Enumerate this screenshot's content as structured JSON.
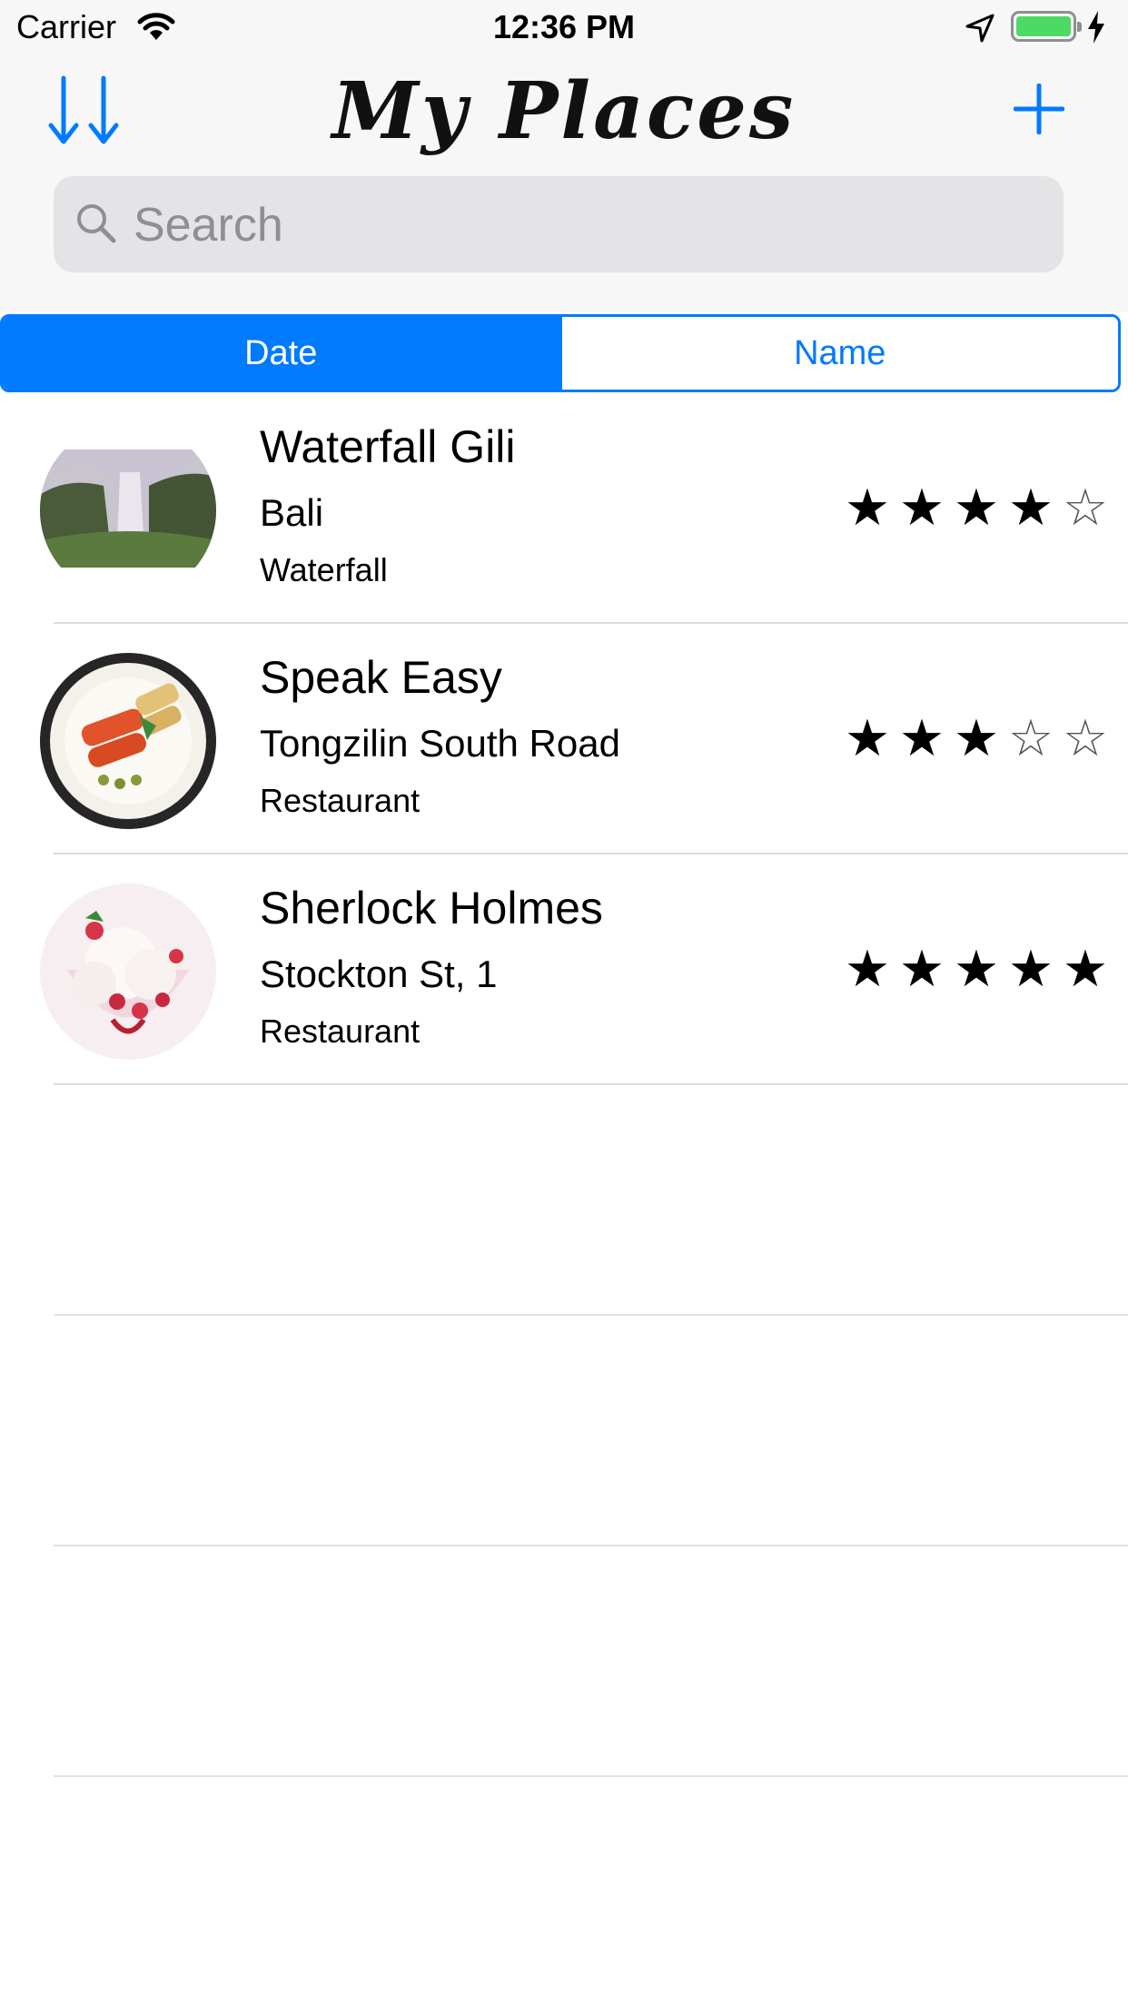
{
  "status_bar": {
    "carrier": "Carrier",
    "time": "12:36 PM",
    "battery_level": 1.0
  },
  "nav": {
    "title": "My Places",
    "sort_icon": "sort-arrows-icon",
    "add_icon": "plus-icon"
  },
  "search": {
    "placeholder": "Search",
    "icon": "search-icon"
  },
  "segments": [
    {
      "label": "Date",
      "selected": true
    },
    {
      "label": "Name",
      "selected": false
    }
  ],
  "places": [
    {
      "name": "Waterfall Gili",
      "location": "Bali",
      "type": "Waterfall",
      "rating": 4,
      "max_rating": 5,
      "image": "waterfall-photo"
    },
    {
      "name": "Speak Easy",
      "location": "Tongzilin South Road",
      "type": "Restaurant",
      "rating": 3,
      "max_rating": 5,
      "image": "food-plate-photo"
    },
    {
      "name": "Sherlock Holmes",
      "location": "Stockton St, 1",
      "type": "Restaurant",
      "rating": 5,
      "max_rating": 5,
      "image": "dessert-photo"
    }
  ],
  "colors": {
    "accent": "#007aff",
    "battery": "#4cd964",
    "bar_background": "#f7f7f7"
  }
}
